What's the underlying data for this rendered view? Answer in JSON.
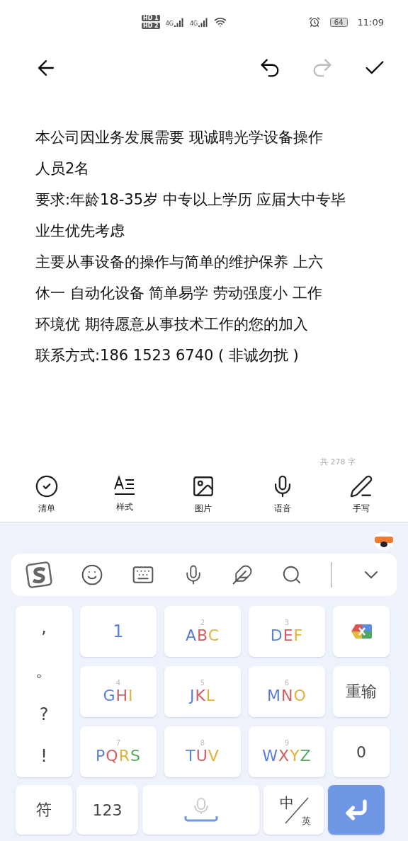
{
  "status_bar": {
    "sim_1": "HD 1",
    "sim_2": "HD 2",
    "network_1": "4G",
    "network_2": "4G",
    "battery": "64",
    "time": "11:09"
  },
  "editor": {
    "lines": [
      "本公司因业务发展需要 现诚聘光学设备操作",
      "人员2名",
      "要求:年龄18-35岁 中专以上学历 应届大中专毕",
      "业生优先考虑",
      "主要从事设备的操作与简单的维护保养 上六",
      "休一 自动化设备 简单易学 劳动强度小 工作",
      "环境优 期待愿意从事技术工作的您的加入",
      "联系方式:186 1523 6740 ( 非诚勿扰 )"
    ],
    "word_count": "共 278 字"
  },
  "note_tools": [
    {
      "kind": "checklist",
      "label": "清单"
    },
    {
      "kind": "style",
      "label": "样式"
    },
    {
      "kind": "image",
      "label": "图片"
    },
    {
      "kind": "voice",
      "label": "语音"
    },
    {
      "kind": "handwriting",
      "label": "手写"
    }
  ],
  "keyboard": {
    "punctuation": [
      ",",
      "。",
      "?",
      "!"
    ],
    "keys": [
      {
        "kind": "digit",
        "letters": "1"
      },
      {
        "kind": "letters",
        "number": "2",
        "letters": "ABC"
      },
      {
        "kind": "letters",
        "number": "3",
        "letters": "DEF"
      },
      {
        "kind": "delete"
      },
      {
        "kind": "letters",
        "number": "4",
        "letters": "GHI"
      },
      {
        "kind": "letters",
        "number": "5",
        "letters": "JKL"
      },
      {
        "kind": "letters",
        "number": "6",
        "letters": "MNO"
      },
      {
        "kind": "text",
        "letters": "重输"
      },
      {
        "kind": "letters",
        "number": "7",
        "letters": "PQRS"
      },
      {
        "kind": "letters",
        "number": "8",
        "letters": "TUV"
      },
      {
        "kind": "letters",
        "number": "9",
        "letters": "WXYZ"
      },
      {
        "kind": "text",
        "letters": "0"
      }
    ],
    "symbols": "符",
    "numbers": "123",
    "lang_main": "中",
    "lang_alt": "英"
  }
}
